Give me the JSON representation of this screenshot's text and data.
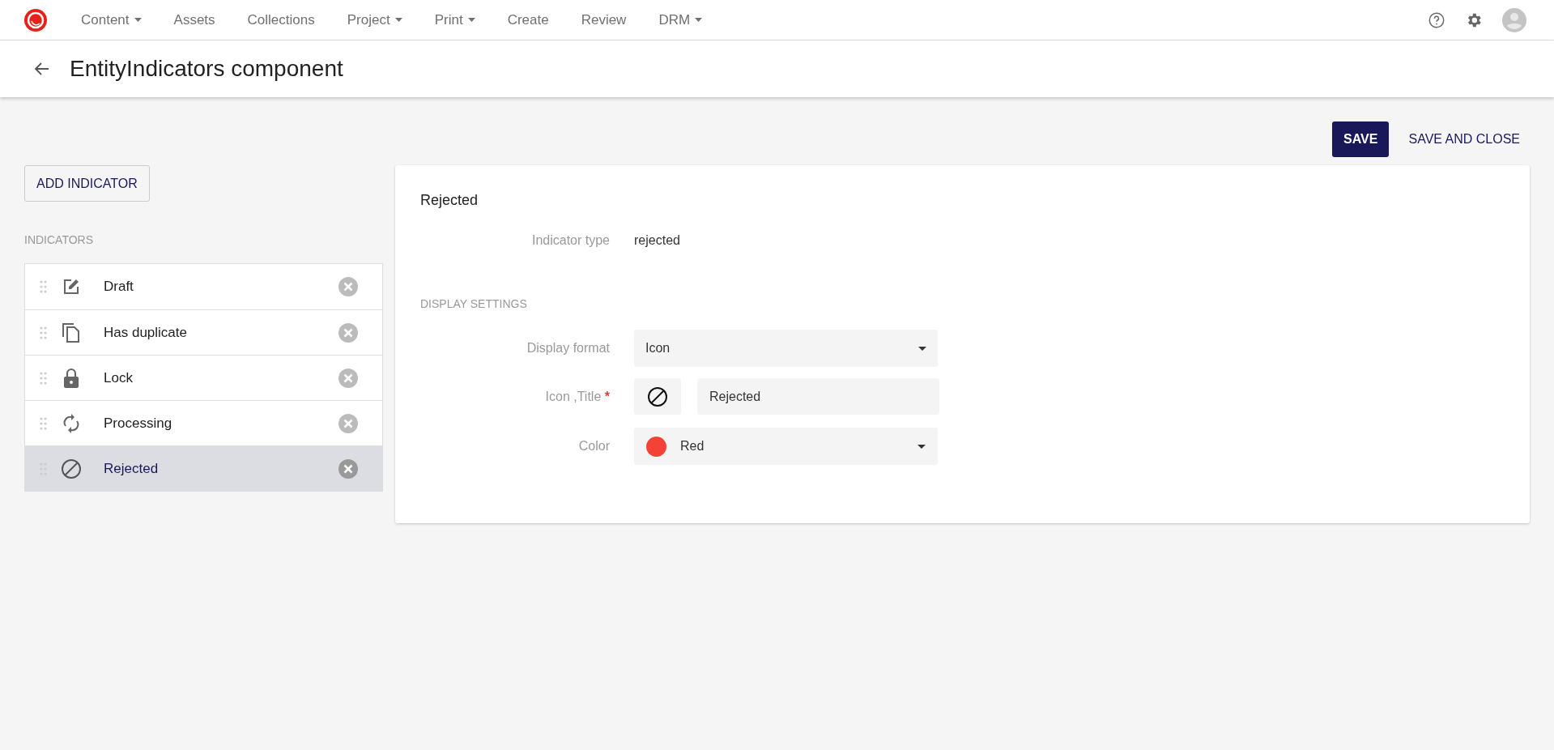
{
  "nav": {
    "items": [
      {
        "label": "Content",
        "has_menu": true
      },
      {
        "label": "Assets",
        "has_menu": false
      },
      {
        "label": "Collections",
        "has_menu": false
      },
      {
        "label": "Project",
        "has_menu": true
      },
      {
        "label": "Print",
        "has_menu": true
      },
      {
        "label": "Create",
        "has_menu": false
      },
      {
        "label": "Review",
        "has_menu": false
      },
      {
        "label": "DRM",
        "has_menu": true
      }
    ]
  },
  "page": {
    "title": "EntityIndicators component"
  },
  "actions": {
    "save": "SAVE",
    "save_and_close": "SAVE AND CLOSE"
  },
  "sidebar": {
    "add_button": "ADD INDICATOR",
    "section_label": "INDICATORS",
    "items": [
      {
        "label": "Draft",
        "kind": "edit",
        "selected": false
      },
      {
        "label": "Has duplicate",
        "kind": "copy",
        "selected": false
      },
      {
        "label": "Lock",
        "kind": "lock",
        "selected": false
      },
      {
        "label": "Processing",
        "kind": "sync",
        "selected": false
      },
      {
        "label": "Rejected",
        "kind": "block",
        "selected": true
      }
    ]
  },
  "detail": {
    "title": "Rejected",
    "indicator_type": {
      "label": "Indicator type",
      "value": "rejected"
    },
    "section_label": "DISPLAY SETTINGS",
    "display_format": {
      "label": "Display format",
      "value": "Icon"
    },
    "icon_title": {
      "label": "Icon ,Title",
      "required_mark": "*",
      "value": "Rejected"
    },
    "color": {
      "label": "Color",
      "value": "Red",
      "color": "#f44336"
    }
  }
}
